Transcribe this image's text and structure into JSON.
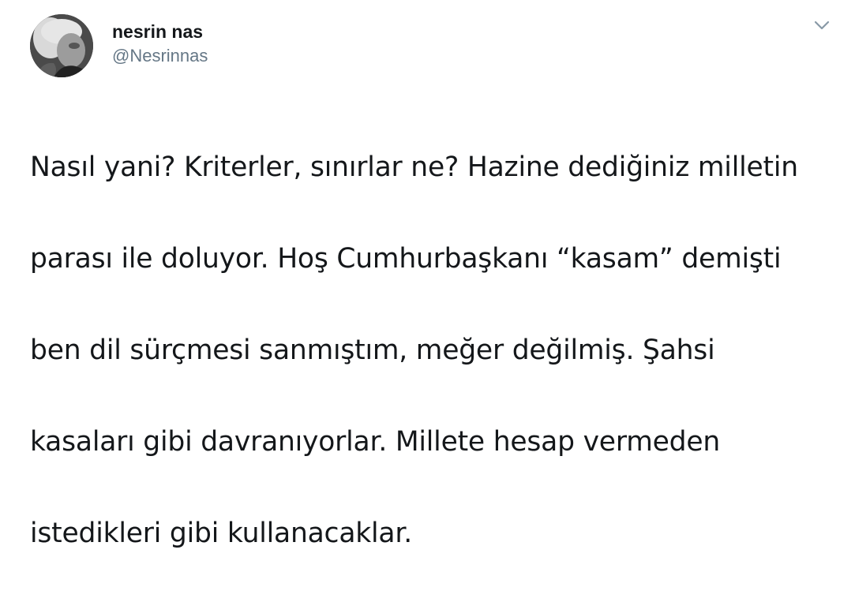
{
  "tweet": {
    "author": {
      "display_name": "nesrin nas",
      "handle": "@Nesrinnas"
    },
    "menu_icon": "chevron-down-icon",
    "text_lines": [
      "Nasıl yani? Kriterler, sınırlar ne? Hazine dediğiniz milletin",
      "parası ile doluyor. Hoş Cumhurbaşkanı “kasam” demişti",
      "ben dil sürçmesi sanmıştım, meğer değilmiş. Şahsi",
      "kasaları gibi davranıyorlar. Millete hesap vermeden",
      "istedikleri gibi kullanacaklar."
    ]
  }
}
